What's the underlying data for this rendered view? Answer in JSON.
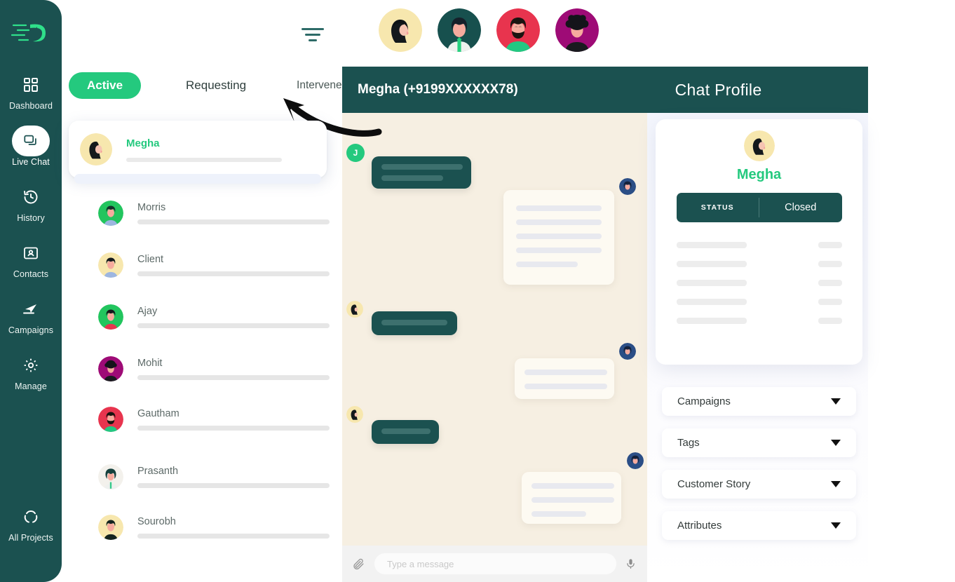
{
  "brand": {
    "logo_icon": "leaf-swoosh-logo"
  },
  "sidebar": {
    "items": [
      {
        "label": "Dashboard",
        "icon": "grid-dashboard-icon",
        "active": false
      },
      {
        "label": "Live Chat",
        "icon": "chat-bubbles-icon",
        "active": true
      },
      {
        "label": "History",
        "icon": "clock-history-icon",
        "active": false
      },
      {
        "label": "Contacts",
        "icon": "contact-card-icon",
        "active": false
      },
      {
        "label": "Campaigns",
        "icon": "paper-plane-icon",
        "active": false
      },
      {
        "label": "Manage",
        "icon": "gear-icon",
        "active": false
      }
    ],
    "bottom_item": {
      "label": "All Projects",
      "icon": "projects-circle-icon"
    },
    "background_color": "#1b5150"
  },
  "topbar": {
    "filter_icon": "filter-lines-icon",
    "avatars": [
      {
        "name": "avatar-woman-hijab",
        "bg": "#f7e7ae"
      },
      {
        "name": "avatar-man-tie",
        "bg": "#1b5150"
      },
      {
        "name": "avatar-man-beard",
        "bg": "#e8344e"
      },
      {
        "name": "avatar-woman-curly",
        "bg": "#9e0b76"
      }
    ]
  },
  "tabs": [
    {
      "label": "Active",
      "selected": true
    },
    {
      "label": "Requesting",
      "selected": false
    },
    {
      "label": "Intervened",
      "selected": false
    }
  ],
  "chat_list": {
    "selected": {
      "name": "Megha",
      "avatar_bg": "#f7e7ae"
    },
    "items": [
      {
        "name": "Morris",
        "avatar_bg": "#22c55e"
      },
      {
        "name": "Client",
        "avatar_bg": "#f7e7ae"
      },
      {
        "name": "Ajay",
        "avatar_bg": "#22c55e"
      },
      {
        "name": "Mohit",
        "avatar_bg": "#9e0b76"
      },
      {
        "name": "Gautham",
        "avatar_bg": "#e8344e"
      },
      {
        "name": "Prasanth",
        "avatar_bg": "#f3f1ec"
      },
      {
        "name": "Sourobh",
        "avatar_bg": "#f7e7ae"
      }
    ]
  },
  "chat": {
    "header_title": "Megha (+9199XXXXXX78)",
    "profile_header_title": "Chat Profile",
    "agent_badge_initial": "J",
    "composer": {
      "attachment_icon": "paperclip-icon",
      "placeholder": "Type a message",
      "value": "",
      "mic_icon": "microphone-icon"
    }
  },
  "profile": {
    "name": "Megha",
    "avatar_bg": "#f7e7ae",
    "status_label": "STATUS",
    "status_value": "Closed",
    "accordion": [
      {
        "label": "Campaigns",
        "caret": "caret-down-icon"
      },
      {
        "label": "Tags",
        "caret": "caret-down-icon"
      },
      {
        "label": "Customer Story",
        "caret": "caret-down-icon"
      },
      {
        "label": "Attributes",
        "caret": "caret-down-icon"
      }
    ]
  },
  "annotation": {
    "arrow_icon": "curved-arrow-up-left",
    "color": "#0d0d0d"
  },
  "colors": {
    "brand_dark": "#1b5150",
    "accent_green": "#24c97e",
    "chat_bg": "#f6efe2",
    "panel_bg": "#f4f6fd"
  }
}
